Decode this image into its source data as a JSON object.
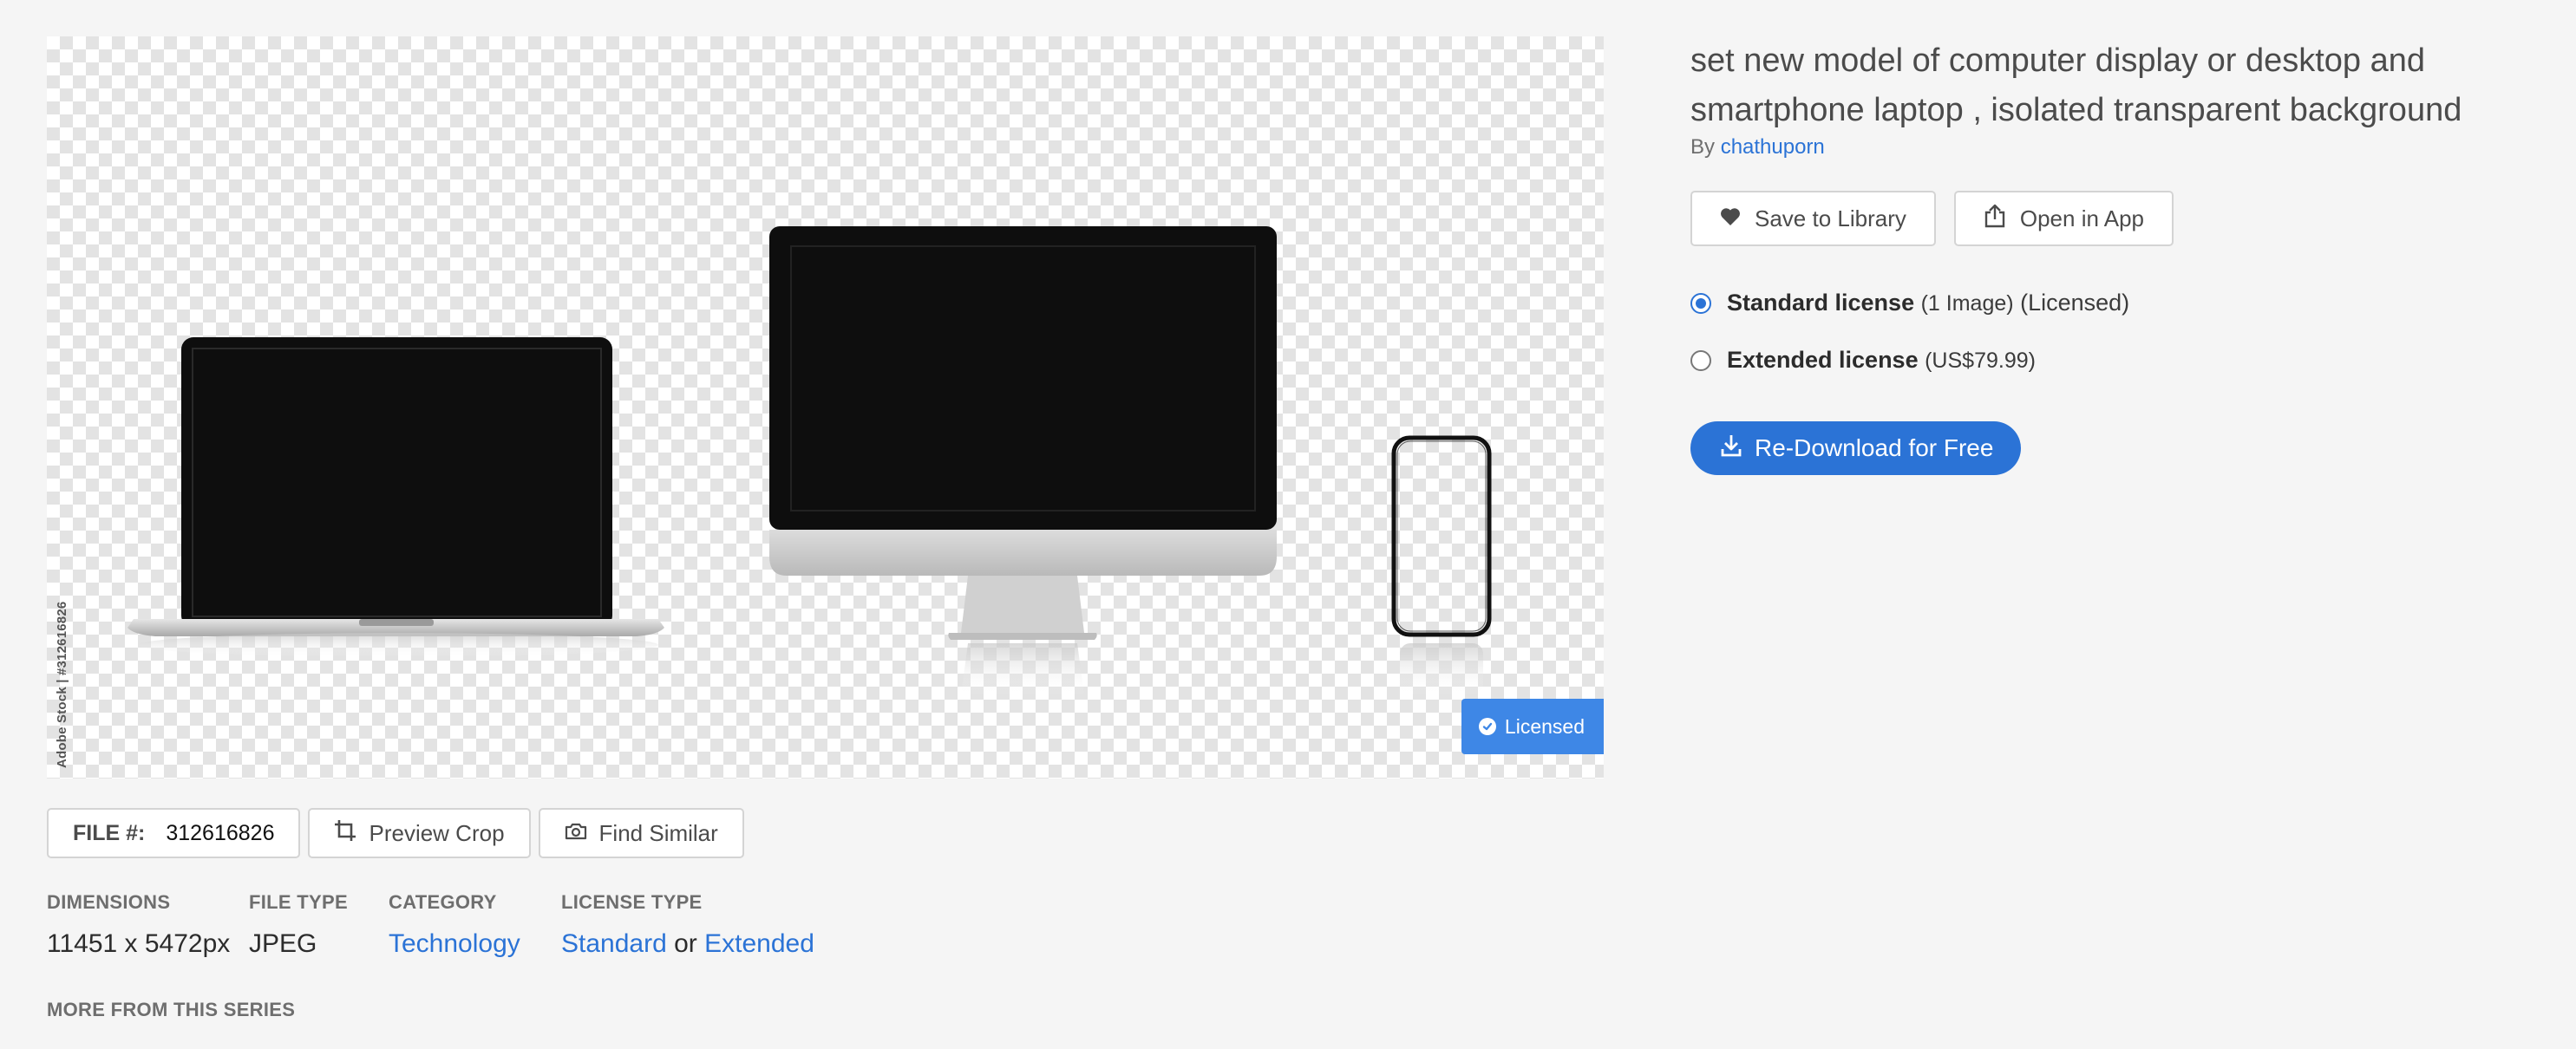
{
  "preview": {
    "watermark": "Adobe Stock | #312616826",
    "badge": "Licensed"
  },
  "toolbar": {
    "file_label": "FILE #:",
    "file_number": "312616826",
    "preview_crop": "Preview Crop",
    "find_similar": "Find Similar"
  },
  "meta": {
    "dimensions_label": "DIMENSIONS",
    "dimensions_value": "11451 x 5472px",
    "filetype_label": "FILE TYPE",
    "filetype_value": "JPEG",
    "category_label": "CATEGORY",
    "category_value": "Technology",
    "licensetype_label": "LICENSE TYPE",
    "license_standard": "Standard",
    "license_or": "or",
    "license_extended": "Extended"
  },
  "more_series": "MORE FROM THIS SERIES",
  "asset": {
    "title": "set new model of computer display or desktop and smartphone laptop , isolated transparent background",
    "by": "By",
    "author": "chathuporn"
  },
  "actions": {
    "save_library": "Save to Library",
    "open_in_app": "Open in App"
  },
  "licenses": {
    "standard_name": "Standard license",
    "standard_detail": "(1 Image)",
    "standard_status": "(Licensed)",
    "extended_name": "Extended license",
    "extended_price": "(US$79.99)",
    "selected": "standard"
  },
  "redownload_label": "Re-Download for Free",
  "colors": {
    "accent": "#2b73d6",
    "badge": "#3e87e6",
    "background": "#f5f5f5"
  }
}
